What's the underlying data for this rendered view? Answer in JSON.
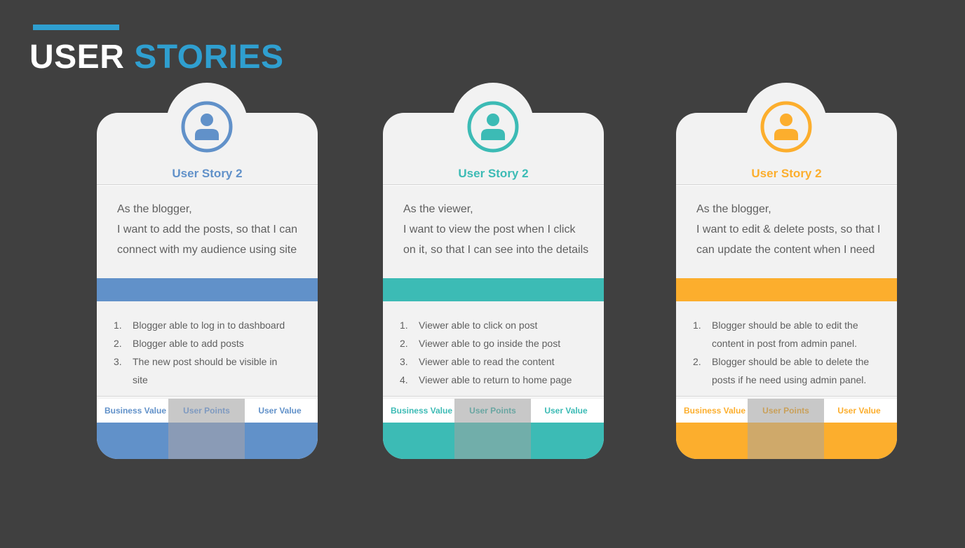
{
  "header": {
    "title_part1": "USER",
    "title_part2": "STORIES",
    "accent_color": "#2f9fd0"
  },
  "cards": [
    {
      "theme_color": "#6191c9",
      "icon": "user-icon",
      "title": "User Story 2",
      "story_lines": [
        "As the blogger,",
        "I want to add the posts, so that I can",
        "connect with my audience using site"
      ],
      "criteria": [
        {
          "num": "1.",
          "lines": [
            "Blogger able to log in to dashboard"
          ]
        },
        {
          "num": "2.",
          "lines": [
            "Blogger able to add posts"
          ]
        },
        {
          "num": "3.",
          "lines": [
            "The new post should be visible in",
            "site"
          ]
        }
      ],
      "metrics": {
        "business_value": "Business Value",
        "user_points": "User Points",
        "user_value": "User Value"
      }
    },
    {
      "theme_color": "#3cbbb5",
      "icon": "user-icon",
      "title": "User Story 2",
      "story_lines": [
        "As the viewer,",
        "I want to view the post when I click",
        "on it, so that I can see into the details"
      ],
      "criteria": [
        {
          "num": "1.",
          "lines": [
            "Viewer able to click on post"
          ]
        },
        {
          "num": "2.",
          "lines": [
            "Viewer able to go inside the post"
          ]
        },
        {
          "num": "3.",
          "lines": [
            "Viewer able to read the content"
          ]
        },
        {
          "num": "4.",
          "lines": [
            "Viewer able to return to home page"
          ]
        }
      ],
      "metrics": {
        "business_value": "Business Value",
        "user_points": "User Points",
        "user_value": "User Value"
      }
    },
    {
      "theme_color": "#fcae2d",
      "icon": "user-icon",
      "title": "User Story 2",
      "story_lines": [
        "As the blogger,",
        "I want to edit & delete posts, so that I",
        "can update the content when I need"
      ],
      "criteria": [
        {
          "num": "1.",
          "lines": [
            "Blogger should be able to edit the",
            "content in post from admin panel."
          ]
        },
        {
          "num": "2.",
          "lines": [
            "Blogger should be able to delete the",
            "posts if he need using admin panel."
          ]
        }
      ],
      "metrics": {
        "business_value": "Business Value",
        "user_points": "User Points",
        "user_value": "User Value"
      }
    }
  ]
}
